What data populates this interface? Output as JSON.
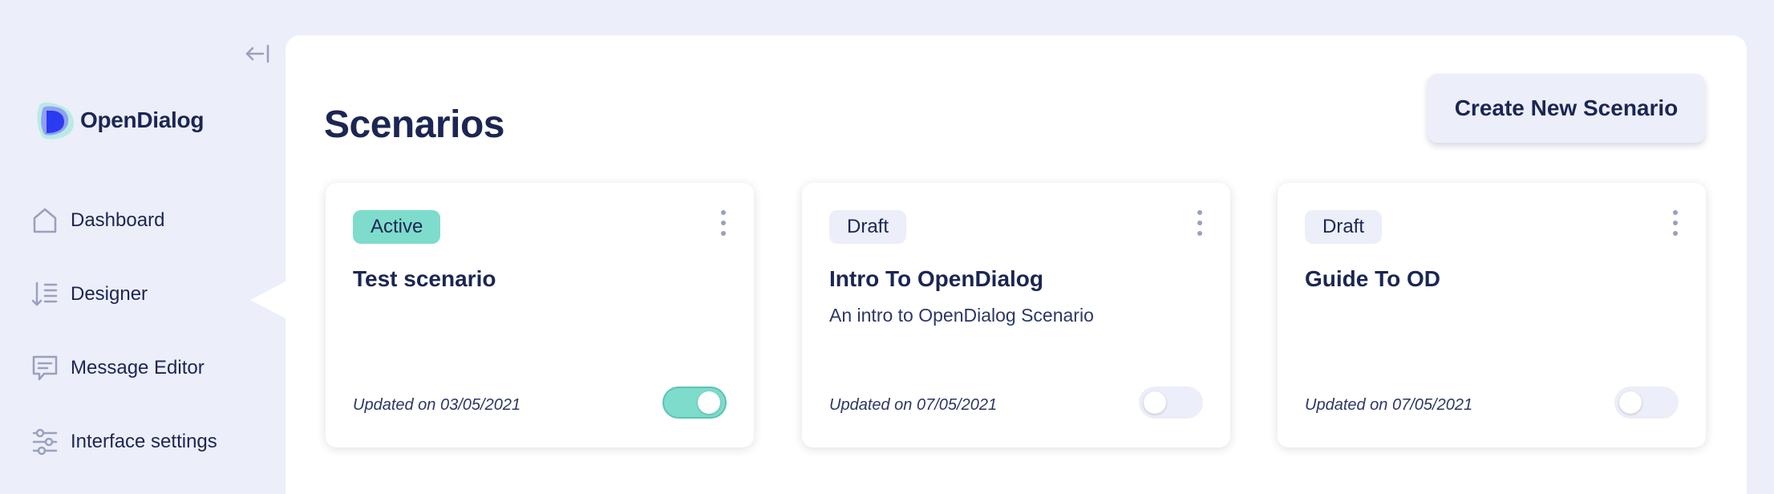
{
  "app": {
    "brand": "OpenDialog"
  },
  "colors": {
    "accent": "#7edccc",
    "navy": "#1b2653",
    "background": "#eceef9",
    "logo_blue": "#2b3cf0"
  },
  "sidebar": {
    "collapse_icon": "collapse-left-icon",
    "items": [
      {
        "label": "Dashboard",
        "icon": "home-icon",
        "active": false
      },
      {
        "label": "Designer",
        "icon": "sort-list-icon",
        "active": true
      },
      {
        "label": "Message Editor",
        "icon": "message-icon",
        "active": false
      },
      {
        "label": "Interface settings",
        "icon": "sliders-icon",
        "active": false
      }
    ]
  },
  "main": {
    "title": "Scenarios",
    "create_button": "Create New Scenario",
    "cards": [
      {
        "status": "Active",
        "title": "Test scenario",
        "description": "",
        "updated": "Updated on 03/05/2021",
        "enabled": true
      },
      {
        "status": "Draft",
        "title": "Intro To OpenDialog",
        "description": "An intro to OpenDialog Scenario",
        "updated": "Updated on 07/05/2021",
        "enabled": false
      },
      {
        "status": "Draft",
        "title": "Guide To OD",
        "description": "",
        "updated": "Updated on 07/05/2021",
        "enabled": false
      }
    ]
  }
}
